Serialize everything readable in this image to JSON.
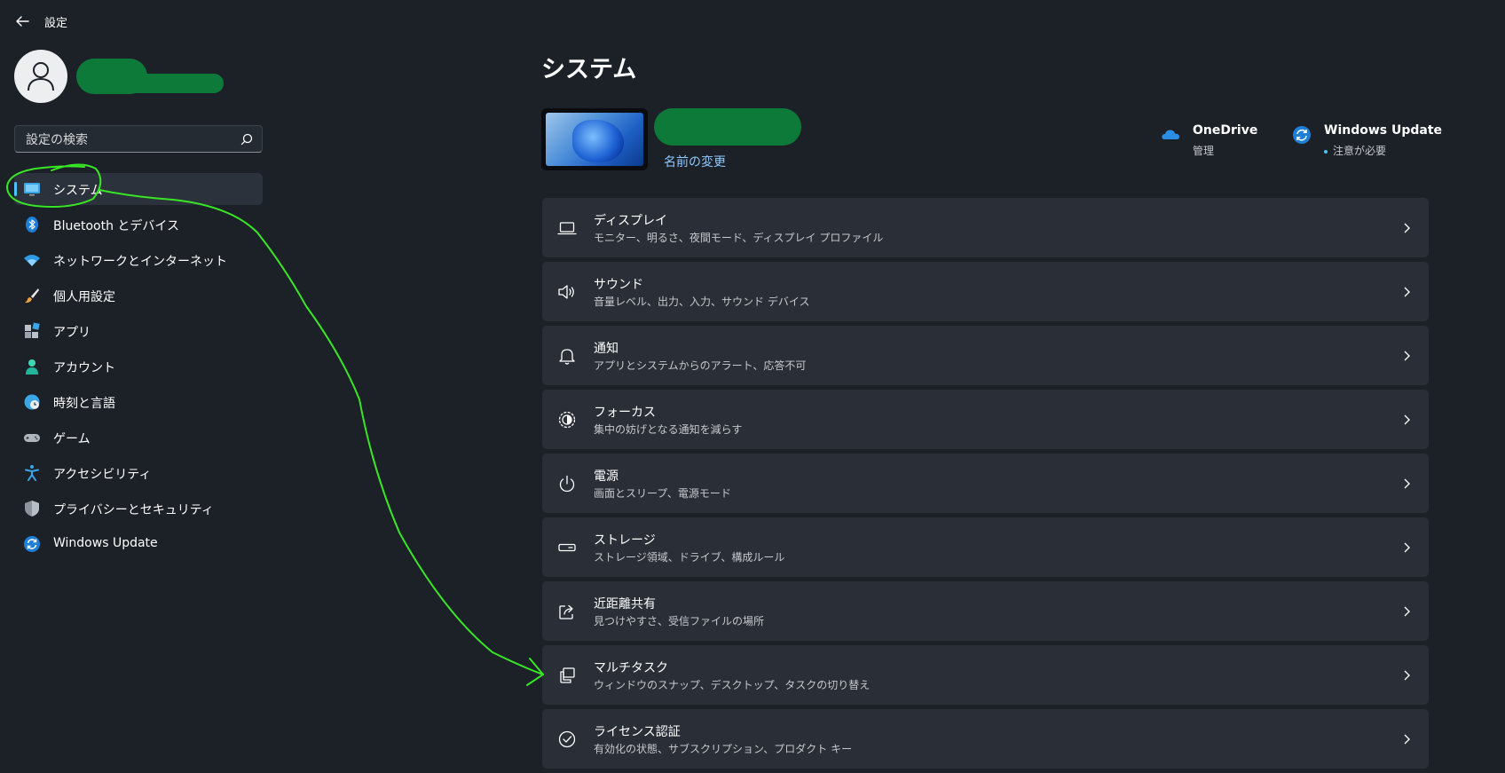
{
  "window": {
    "title": "設定",
    "back_icon": "back-arrow-icon"
  },
  "search": {
    "placeholder": "設定の検索",
    "icon": "search-icon"
  },
  "sidebar": {
    "items": [
      {
        "label": "システム",
        "icon": "monitor-icon",
        "active": true
      },
      {
        "label": "Bluetooth とデバイス",
        "icon": "bluetooth-icon"
      },
      {
        "label": "ネットワークとインターネット",
        "icon": "wifi-icon"
      },
      {
        "label": "個人用設定",
        "icon": "paintbrush-icon"
      },
      {
        "label": "アプリ",
        "icon": "apps-icon"
      },
      {
        "label": "アカウント",
        "icon": "person-icon"
      },
      {
        "label": "時刻と言語",
        "icon": "globe-clock-icon"
      },
      {
        "label": "ゲーム",
        "icon": "gamepad-icon"
      },
      {
        "label": "アクセシビリティ",
        "icon": "accessibility-icon"
      },
      {
        "label": "プライバシーとセキュリティ",
        "icon": "shield-icon"
      },
      {
        "label": "Windows Update",
        "icon": "sync-icon"
      }
    ]
  },
  "main": {
    "title": "システム",
    "device": {
      "rename_label": "名前の変更"
    },
    "quick_links": [
      {
        "title": "OneDrive",
        "subtitle": "管理",
        "icon": "cloud-icon"
      },
      {
        "title": "Windows Update",
        "subtitle": "注意が必要",
        "icon": "sync-icon"
      }
    ],
    "cards": [
      {
        "title": "ディスプレイ",
        "subtitle": "モニター、明るさ、夜間モード、ディスプレイ プロファイル",
        "icon": "laptop-icon"
      },
      {
        "title": "サウンド",
        "subtitle": "音量レベル、出力、入力、サウンド デバイス",
        "icon": "speaker-icon"
      },
      {
        "title": "通知",
        "subtitle": "アプリとシステムからのアラート、応答不可",
        "icon": "bell-icon"
      },
      {
        "title": "フォーカス",
        "subtitle": "集中の妨げとなる通知を減らす",
        "icon": "focus-icon"
      },
      {
        "title": "電源",
        "subtitle": "画面とスリープ、電源モード",
        "icon": "power-icon"
      },
      {
        "title": "ストレージ",
        "subtitle": "ストレージ領域、ドライブ、構成ルール",
        "icon": "storage-icon"
      },
      {
        "title": "近距離共有",
        "subtitle": "見つけやすさ、受信ファイルの場所",
        "icon": "share-icon"
      },
      {
        "title": "マルチタスク",
        "subtitle": "ウィンドウのスナップ、デスクトップ、タスクの切り替え",
        "icon": "multitask-icon"
      },
      {
        "title": "ライセンス認証",
        "subtitle": "有効化の状態、サブスクリプション、プロダクト キー",
        "icon": "check-circle-icon"
      }
    ]
  },
  "colors": {
    "background": "#1c2128",
    "card": "#2a2f37",
    "accent": "#4cc2ff",
    "link": "#8dc8ff",
    "annotation": "#39e626",
    "redaction": "#0e7a3a"
  }
}
